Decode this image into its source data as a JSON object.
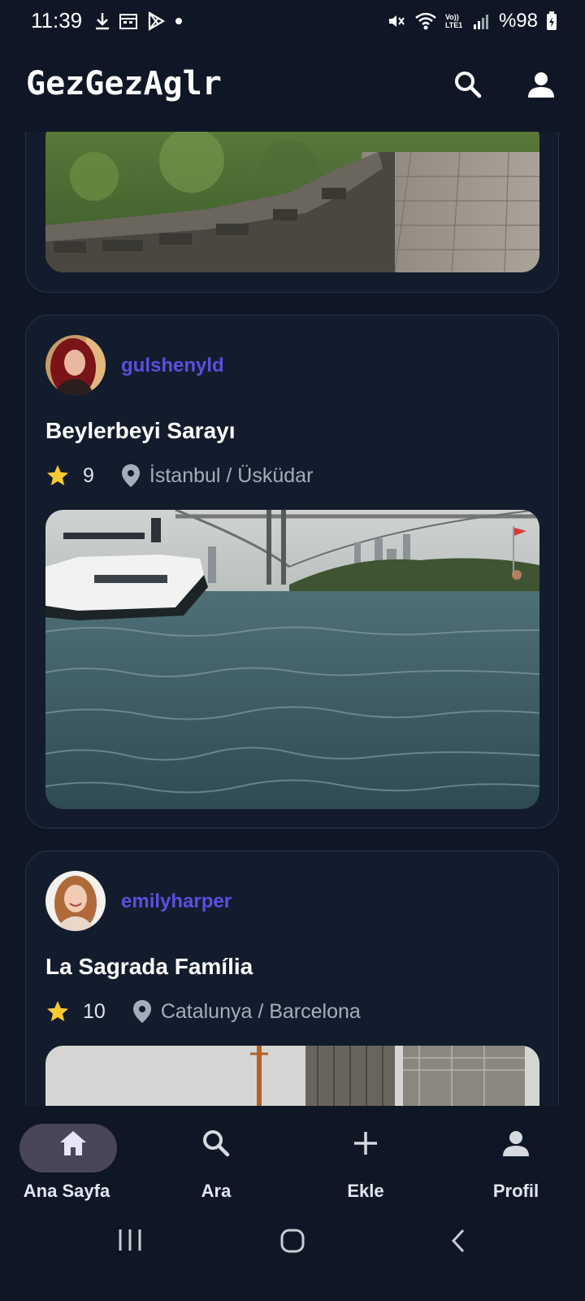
{
  "status": {
    "time": "11:39",
    "battery_text": "%98",
    "network_label": "Vo)) LTE1"
  },
  "app": {
    "title": "GezGezAglr"
  },
  "posts": [
    {
      "username": "gulshenyld",
      "place": "Beylerbeyi Sarayı",
      "rating": "9",
      "location": "İstanbul / Üsküdar"
    },
    {
      "username": "emilyharper",
      "place": "La Sagrada Família",
      "rating": "10",
      "location": "Catalunya / Barcelona"
    }
  ],
  "nav": {
    "items": [
      {
        "label": "Ana Sayfa",
        "icon": "home-icon",
        "active": true
      },
      {
        "label": "Ara",
        "icon": "search-icon"
      },
      {
        "label": "Ekle",
        "icon": "plus-icon"
      },
      {
        "label": "Profil",
        "icon": "person-icon"
      }
    ]
  },
  "colors": {
    "background": "#0f1726",
    "card": "#131c2c",
    "username": "#5b4fe0",
    "star": "#f9c934",
    "active_pill": "#4a4559"
  }
}
